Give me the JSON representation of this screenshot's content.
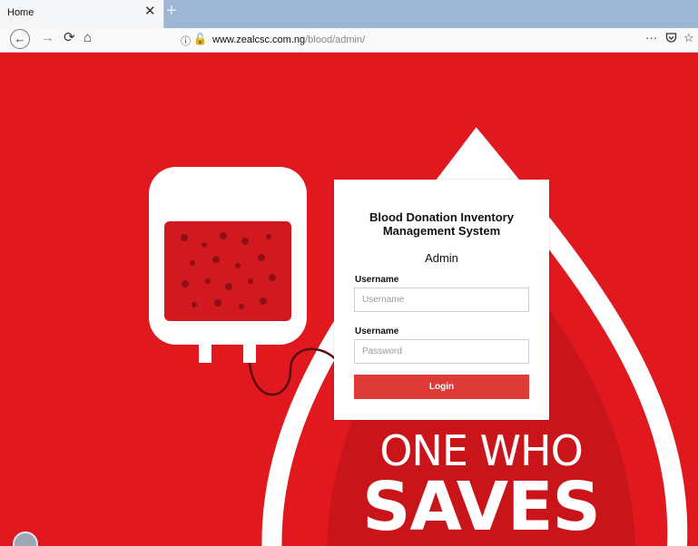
{
  "browser": {
    "tab_title": "Home",
    "tab_close_icon": "close-icon",
    "new_tab_icon": "plus-icon",
    "url_host": "www.zealcsc.com.ng",
    "url_path": "/blood/admin/",
    "icons": [
      "back-arrow-icon",
      "forward-arrow-icon",
      "reload-icon",
      "home-icon",
      "info-icon",
      "insecure-lock-icon",
      "more-dots-icon",
      "pocket-icon",
      "star-icon"
    ]
  },
  "login": {
    "title_line1": "Blood Donation Inventory",
    "title_line2": "Management System",
    "subtitle": "Admin",
    "username_label": "Username",
    "username_placeholder": "Username",
    "password_label": "Username",
    "password_placeholder": "Password",
    "submit_label": "Login"
  },
  "banner": {
    "line1": "ONE WHO",
    "line2": "SAVES"
  },
  "colors": {
    "page_background": "#e2181f",
    "button": "#dd3a38",
    "tab_strip": "#9cb6d3"
  }
}
